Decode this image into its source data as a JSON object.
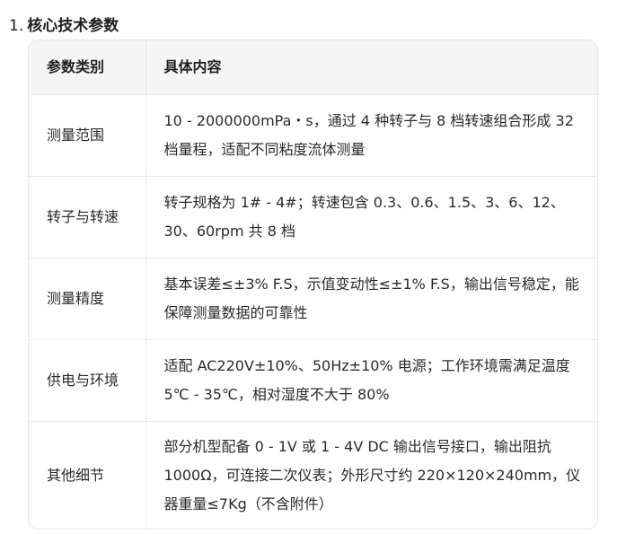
{
  "section": {
    "number": "1.",
    "title": "核心技术参数"
  },
  "table": {
    "headers": [
      "参数类别",
      "具体内容"
    ],
    "rows": [
      {
        "category": "测量范围",
        "content": "10 - 2000000mPa・s，通过 4 种转子与 8 档转速组合形成 32 档量程，适配不同粘度流体测量"
      },
      {
        "category": "转子与转速",
        "content": "转子规格为 1# - 4#；转速包含 0.3、0.6、1.5、3、6、12、30、60rpm 共 8 档"
      },
      {
        "category": "测量精度",
        "content": "基本误差≤±3% F.S，示值变动性≤±1% F.S，输出信号稳定，能保障测量数据的可靠性"
      },
      {
        "category": "供电与环境",
        "content": "适配 AC220V±10%、50Hz±10% 电源；工作环境需满足温度 5℃ - 35℃，相对湿度不大于 80%"
      },
      {
        "category": "其他细节",
        "content": "部分机型配备 0 - 1V 或 1 - 4V DC 输出信号接口，输出阻抗 1000Ω，可连接二次仪表；外形尺寸约 220×120×240mm，仪器重量≤7Kg（不含附件）"
      }
    ]
  }
}
